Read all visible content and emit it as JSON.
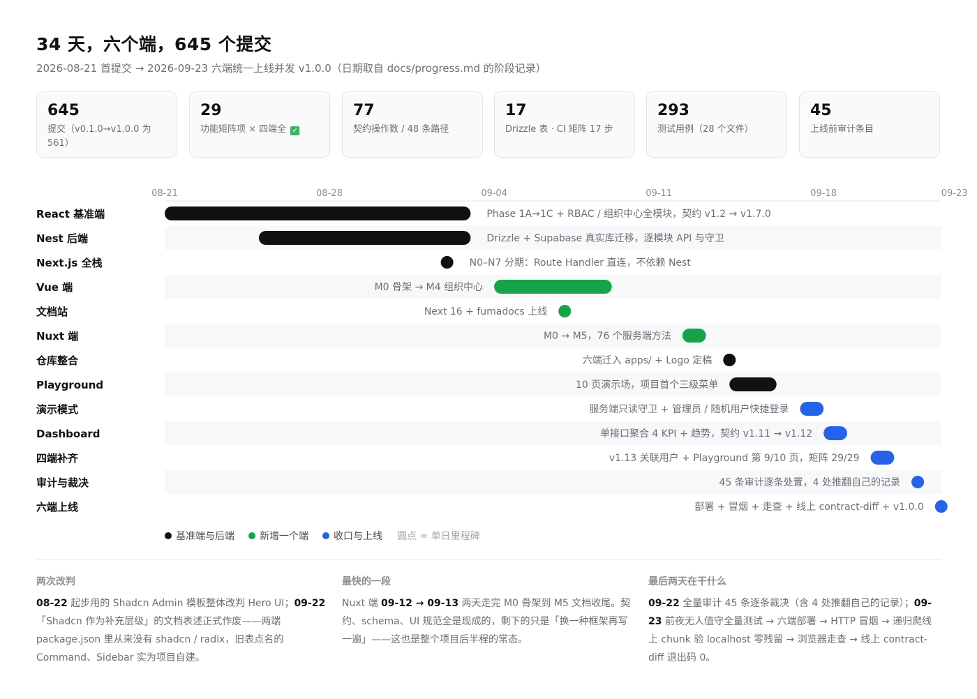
{
  "header": {
    "title": "34 天，六个端，645 个提交",
    "subtitle": "2026-08-21 首提交 → 2026-09-23 六端统一上线并发 v1.0.0（日期取自 docs/progress.md 的阶段记录）"
  },
  "stats": [
    {
      "value": "645",
      "label": "提交（v0.1.0→v1.0.0 为 561）"
    },
    {
      "value": "29",
      "label": "功能矩阵项 × 四端全",
      "check": "✓"
    },
    {
      "value": "77",
      "label": "契约操作数 / 48 条路径"
    },
    {
      "value": "17",
      "label": "Drizzle 表 · CI 矩阵 17 步"
    },
    {
      "value": "293",
      "label": "测试用例（28 个文件）"
    },
    {
      "value": "45",
      "label": "上线前审计条目"
    }
  ],
  "colors": {
    "black": "#111111",
    "green": "#16a34a",
    "blue": "#2563eb"
  },
  "chart_data": {
    "type": "gantt",
    "x_start": "2026-08-21",
    "x_end": "2026-09-23",
    "ticks": [
      {
        "date": "2026-08-21",
        "label": "08-21"
      },
      {
        "date": "2026-08-28",
        "label": "08-28"
      },
      {
        "date": "2026-09-04",
        "label": "09-04"
      },
      {
        "date": "2026-09-11",
        "label": "09-11"
      },
      {
        "date": "2026-09-18",
        "label": "09-18"
      },
      {
        "date": "2026-09-23",
        "label": "09-23"
      }
    ],
    "tasks": [
      {
        "name": "React 基准端",
        "start": "2026-08-21",
        "end": "2026-09-03",
        "color": "black",
        "note": "Phase 1A→1C + RBAC / 组织中心全模块，契约 v1.2 → v1.7.0",
        "note_side": "right"
      },
      {
        "name": "Nest 后端",
        "start": "2026-08-25",
        "end": "2026-09-03",
        "color": "black",
        "note": "Drizzle + Supabase 真实库迁移，逐模块 API 与守卫",
        "note_side": "right"
      },
      {
        "name": "Next.js 全栈",
        "start": "2026-09-02",
        "end": "2026-09-02",
        "color": "black",
        "note": "N0–N7 分期：Route Handler 直连，不依赖 Nest",
        "note_side": "right"
      },
      {
        "name": "Vue 端",
        "start": "2026-09-04",
        "end": "2026-09-09",
        "color": "green",
        "note": "M0 骨架 → M4 组织中心",
        "note_side": "left"
      },
      {
        "name": "文档站",
        "start": "2026-09-07",
        "end": "2026-09-07",
        "color": "green",
        "note": "Next 16 + fumadocs 上线",
        "note_side": "left"
      },
      {
        "name": "Nuxt 端",
        "start": "2026-09-12",
        "end": "2026-09-13",
        "color": "green",
        "note": "M0 → M5，76 个服务端方法",
        "note_side": "left"
      },
      {
        "name": "仓库整合",
        "start": "2026-09-14",
        "end": "2026-09-14",
        "color": "black",
        "note": "六端迁入 apps/ + Logo 定稿",
        "note_side": "left"
      },
      {
        "name": "Playground",
        "start": "2026-09-14",
        "end": "2026-09-16",
        "color": "black",
        "note": "10 页演示场，项目首个三级菜单",
        "note_side": "left"
      },
      {
        "name": "演示模式",
        "start": "2026-09-17",
        "end": "2026-09-18",
        "color": "blue",
        "note": "服务端只读守卫 + 管理员 / 随机用户快捷登录",
        "note_side": "left"
      },
      {
        "name": "Dashboard",
        "start": "2026-09-18",
        "end": "2026-09-19",
        "color": "blue",
        "note": "单接口聚合 4 KPI + 趋势，契约 v1.11 → v1.12",
        "note_side": "left"
      },
      {
        "name": "四端补齐",
        "start": "2026-09-20",
        "end": "2026-09-21",
        "color": "blue",
        "note": "v1.13 关联用户 + Playground 第 9/10 页，矩阵 29/29",
        "note_side": "left"
      },
      {
        "name": "审计与裁决",
        "start": "2026-09-22",
        "end": "2026-09-22",
        "color": "blue",
        "note": "45 条审计逐条处置，4 处推翻自己的记录",
        "note_side": "left"
      },
      {
        "name": "六端上线",
        "start": "2026-09-23",
        "end": "2026-09-23",
        "color": "blue",
        "note": "部署 + 冒烟 + 走查 + 线上 contract-diff + v1.0.0",
        "note_side": "left"
      }
    ],
    "legend": [
      {
        "color": "black",
        "label": "基准端与后端"
      },
      {
        "color": "green",
        "label": "新增一个端"
      },
      {
        "color": "blue",
        "label": "收口与上线"
      }
    ],
    "legend_note": "圆点 = 单日里程碑"
  },
  "notes": [
    {
      "heading": "两次改判",
      "parts": [
        {
          "t": "08-22",
          "b": true
        },
        {
          "t": " 起步用的 Shadcn Admin 模板整体改判 Hero UI；",
          "b": false
        },
        {
          "t": "09-22",
          "b": true
        },
        {
          "t": "「Shadcn 作为补充层级」的文档表述正式作废——两端 package.json 里从来没有 shadcn / radix，旧表点名的 Command、Sidebar 实为项目自建。",
          "b": false
        }
      ]
    },
    {
      "heading": "最快的一段",
      "parts": [
        {
          "t": "Nuxt 端 ",
          "b": false
        },
        {
          "t": "09-12 → 09-13",
          "b": true
        },
        {
          "t": " 两天走完 M0 骨架到 M5 文档收尾。契约、schema、UI 规范全是现成的，剩下的只是「换一种框架再写一遍」——这也是整个项目后半程的常态。",
          "b": false
        }
      ]
    },
    {
      "heading": "最后两天在干什么",
      "parts": [
        {
          "t": "09-22",
          "b": true
        },
        {
          "t": " 全量审计 45 条逐条裁决（含 4 处推翻自己的记录）；",
          "b": false
        },
        {
          "t": "09-23",
          "b": true
        },
        {
          "t": " 前夜无人值守全量测试 → 六端部署 → HTTP 冒烟 → 递归爬线上 chunk 验 localhost 零残留 → 浏览器走查 → 线上 contract-diff 退出码 0。",
          "b": false
        }
      ]
    }
  ]
}
